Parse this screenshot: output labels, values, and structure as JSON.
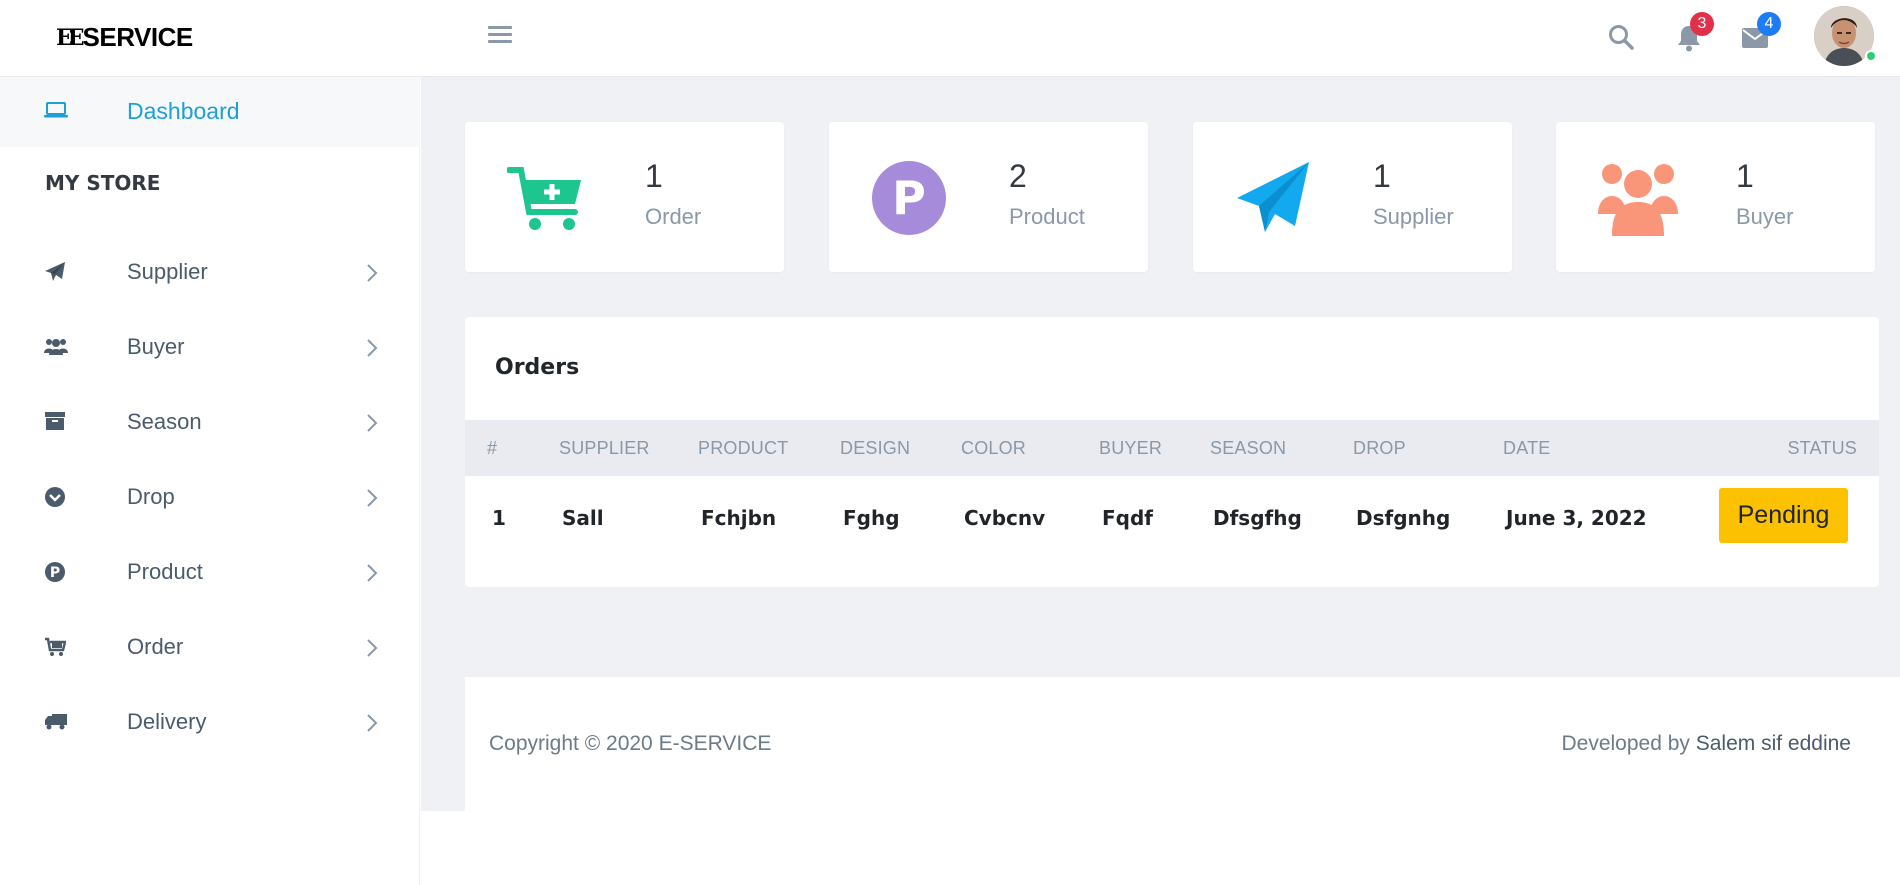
{
  "brand": {
    "logo_mark": "EE",
    "logo_text": "SERVICE"
  },
  "header": {
    "notifications_count": "3",
    "messages_count": "4"
  },
  "sidebar": {
    "dashboard_label": "Dashboard",
    "section_title": "MY STORE",
    "items": [
      {
        "label": "Supplier",
        "icon": "paper-plane-icon"
      },
      {
        "label": "Buyer",
        "icon": "users-icon"
      },
      {
        "label": "Season",
        "icon": "archive-icon"
      },
      {
        "label": "Drop",
        "icon": "chevron-circle-icon"
      },
      {
        "label": "Product",
        "icon": "product-p-icon"
      },
      {
        "label": "Order",
        "icon": "cart-icon"
      },
      {
        "label": "Delivery",
        "icon": "truck-icon"
      }
    ]
  },
  "stats": [
    {
      "value": "1",
      "label": "Order",
      "icon": "cart-plus-icon",
      "color": "#1dc58f"
    },
    {
      "value": "2",
      "label": "Product",
      "icon": "product-p-icon",
      "color": "#a78bdb"
    },
    {
      "value": "1",
      "label": "Supplier",
      "icon": "paper-plane-icon",
      "color": "#12a9ee"
    },
    {
      "value": "1",
      "label": "Buyer",
      "icon": "users-icon",
      "color": "#f9967a"
    }
  ],
  "orders": {
    "title": "Orders",
    "columns": [
      "#",
      "SUPPLIER",
      "PRODUCT",
      "DESIGN",
      "COLOR",
      "BUYER",
      "SEASON",
      "DROP",
      "DATE",
      "STATUS"
    ],
    "rows": [
      {
        "num": "1",
        "supplier": "Sall",
        "product": "Fchjbn",
        "design": "Fghg",
        "color": "Cvbcnv",
        "buyer": "Fqdf",
        "season": "Dfsgfhg",
        "drop": "Dsfgnhg",
        "date": "June 3, 2022",
        "status": "Pending"
      }
    ]
  },
  "footer": {
    "copyright": "Copyright © 2020 E-SERVICE",
    "developed_by": "Developed by",
    "author": "Salem sif eddine"
  },
  "colors": {
    "accent": "#1da1d4",
    "status_pending": "#fcc100",
    "badge_red": "#e0304a",
    "badge_blue": "#1d7cf2"
  }
}
